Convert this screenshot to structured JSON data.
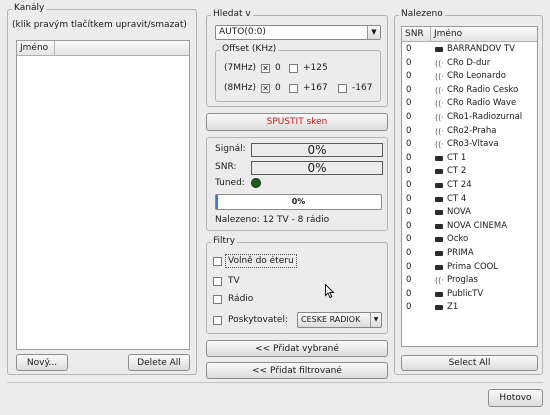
{
  "kanaly": {
    "title": "Kanály",
    "hint": "(klik pravým tlačítkem upravit/smazat)",
    "column": "Jméno",
    "new_button": "Nový...",
    "delete_all_button": "Delete All"
  },
  "hledat": {
    "title": "Hledat v",
    "select_value": "AUTO(0:0)",
    "offset": {
      "title": "Offset (KHz)",
      "row1_label": "(7MHz)",
      "row1_options": [
        {
          "label": "0",
          "checked": true
        },
        {
          "label": "+125",
          "checked": false
        }
      ],
      "row2_label": "(8MHz)",
      "row2_options": [
        {
          "label": "0",
          "checked": true
        },
        {
          "label": "+167",
          "checked": false
        },
        {
          "label": "-167",
          "checked": false
        }
      ]
    },
    "scan_button": "SPUSTIT sken"
  },
  "status": {
    "signal_label": "Signál:",
    "signal_value": "0%",
    "snr_label": "SNR:",
    "snr_value": "0%",
    "tuned_label": "Tuned:",
    "tuned_color": "#1f5e1f",
    "progress_value": "0%",
    "found_text": "Nalezeno: 12 TV - 8 rádio"
  },
  "filtry": {
    "title": "Filtry",
    "free_label": "Volně do éteru",
    "tv_label": "TV",
    "radio_label": "Rádio",
    "provider_label": "Poskytovatel:",
    "provider_value": "CESKE RADIOK"
  },
  "actions": {
    "add_selected": "<< Přidat vybrané",
    "add_filtered": "<< Přidat filtrované"
  },
  "nalezeno": {
    "title": "Nalezeno",
    "col_snr": "SNR",
    "col_name": "Jméno",
    "rows": [
      {
        "snr": "0",
        "type": "tv",
        "name": "BARRANDOV TV"
      },
      {
        "snr": "0",
        "type": "radio",
        "name": "CRo D-dur"
      },
      {
        "snr": "0",
        "type": "radio",
        "name": "CRo Leonardo"
      },
      {
        "snr": "0",
        "type": "radio",
        "name": "CRo Radio Cesko"
      },
      {
        "snr": "0",
        "type": "radio",
        "name": "CRo Radio Wave"
      },
      {
        "snr": "0",
        "type": "radio",
        "name": "CRo1-Radiozurnal"
      },
      {
        "snr": "0",
        "type": "radio",
        "name": "CRo2-Praha"
      },
      {
        "snr": "0",
        "type": "radio",
        "name": "CRo3-Vltava"
      },
      {
        "snr": "0",
        "type": "tv",
        "name": "CT 1"
      },
      {
        "snr": "0",
        "type": "tv",
        "name": "CT 2"
      },
      {
        "snr": "0",
        "type": "tv",
        "name": "CT 24"
      },
      {
        "snr": "0",
        "type": "tv",
        "name": "CT 4"
      },
      {
        "snr": "0",
        "type": "tv",
        "name": "NOVA"
      },
      {
        "snr": "0",
        "type": "tv",
        "name": "NOVA CINEMA"
      },
      {
        "snr": "0",
        "type": "tv",
        "name": "Ocko"
      },
      {
        "snr": "0",
        "type": "tv",
        "name": "PRIMA"
      },
      {
        "snr": "0",
        "type": "tv",
        "name": "Prima COOL"
      },
      {
        "snr": "0",
        "type": "radio",
        "name": "Proglas"
      },
      {
        "snr": "0",
        "type": "tv",
        "name": "PublicTV"
      },
      {
        "snr": "0",
        "type": "tv",
        "name": "Z1"
      }
    ],
    "select_all_button": "Select All"
  },
  "footer": {
    "done_button": "Hotovo"
  },
  "colors": {
    "scan_text": "#c41a1a",
    "progress_fill": "#4a78c0"
  }
}
